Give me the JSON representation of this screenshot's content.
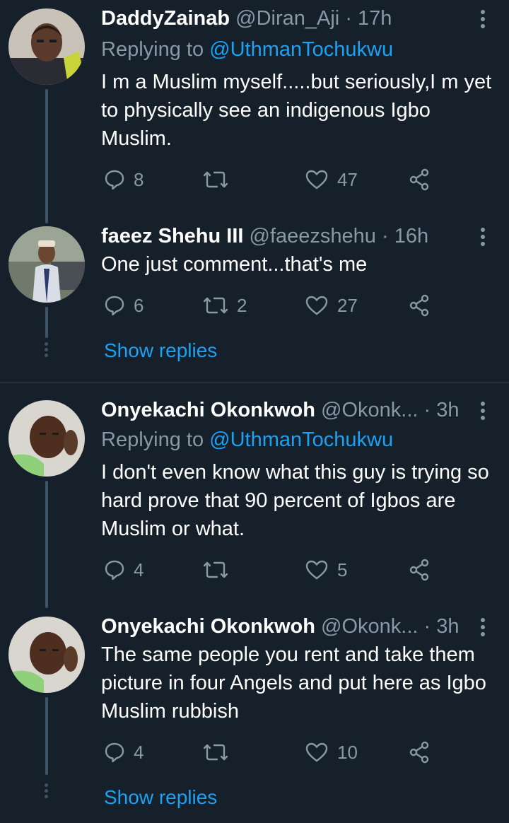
{
  "tweets": [
    {
      "name": "DaddyZainab",
      "handle": "@Diran_Aji",
      "time": "· 17h",
      "replying_prefix": "Replying to ",
      "replying_to": "@UthmanTochukwu",
      "text": "I m a Muslim myself.....but seriously,I m yet to physically see an indigenous Igbo Muslim.",
      "replies": "8",
      "retweets": "",
      "likes": "47"
    },
    {
      "name": "faeez Shehu III",
      "handle": "@faeezshehu",
      "time": "· 16h",
      "text": "One just comment...that's me",
      "replies": "6",
      "retweets": "2",
      "likes": "27"
    },
    {
      "name": "Onyekachi Okonkwoh",
      "handle": "@Okonk...",
      "time": "· 3h",
      "replying_prefix": "Replying to ",
      "replying_to": "@UthmanTochukwu",
      "text": "I don't even know what this guy is trying so hard prove that 90 percent of Igbos are Muslim or what.",
      "replies": "4",
      "retweets": "",
      "likes": "5"
    },
    {
      "name": "Onyekachi Okonkwoh",
      "handle": "@Okonk...",
      "time": "· 3h",
      "text": "The same people you rent and take them picture in four Angels and put here as Igbo Muslim rubbish",
      "replies": "4",
      "retweets": "",
      "likes": "10"
    }
  ],
  "show_replies_label": "Show replies",
  "colors": {
    "background": "#15202b",
    "text": "#ffffff",
    "muted": "#8899a6",
    "accent": "#1da1f2",
    "thread_line": "#3d5466"
  },
  "icons": [
    "reply-icon",
    "retweet-icon",
    "like-icon",
    "share-icon",
    "more-options-icon"
  ]
}
